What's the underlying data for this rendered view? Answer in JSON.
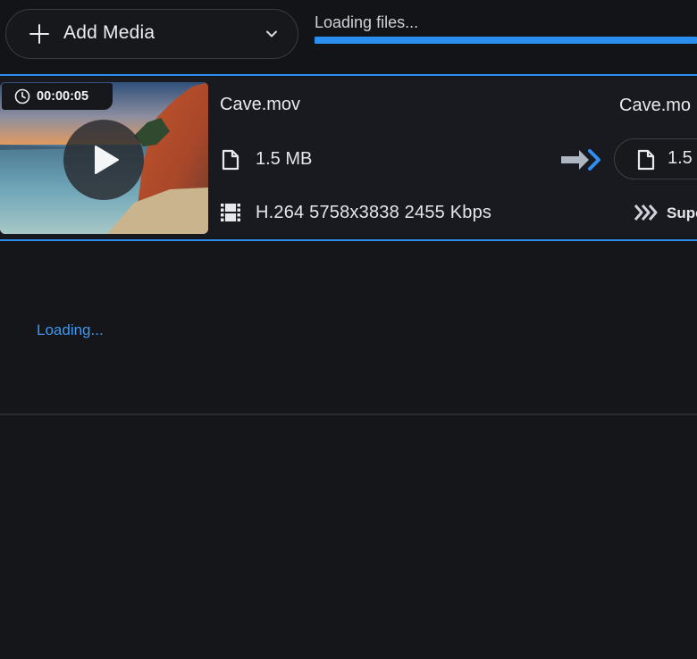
{
  "toolbar": {
    "add_media_label": "Add Media",
    "status_text": "Loading files...",
    "progress": 1.0
  },
  "colors": {
    "accent": "#2b8ff0",
    "background": "#15161a",
    "loading_text": "#3f97f2"
  },
  "file": {
    "duration": "00:00:05",
    "name": "Cave.mov",
    "size": "1.5 MB",
    "codec_info": "H.264 5758x3838 2455 Kbps"
  },
  "output": {
    "name": "Cave.mo",
    "size": "1.5",
    "quality": "Supe"
  },
  "list": {
    "loading_text": "Loading..."
  },
  "icons": [
    "plus-icon",
    "chevron-down-icon",
    "clock-icon",
    "play-icon",
    "file-icon",
    "film-icon",
    "convert-arrow-icon",
    "super-speed-icon"
  ]
}
